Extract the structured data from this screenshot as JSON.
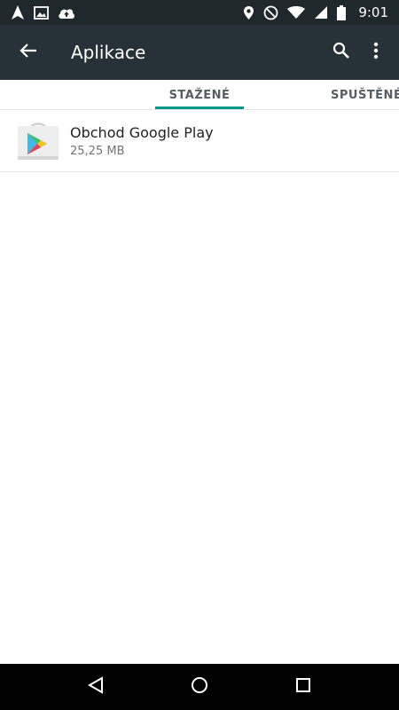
{
  "status_bar": {
    "time": "9:01",
    "left_icons": [
      "navigation-arrow-icon",
      "image-icon",
      "cloud-upload-icon"
    ],
    "right_icons": [
      "location-pin-icon",
      "do-not-disturb-icon",
      "wifi-icon",
      "cellular-signal-icon",
      "battery-icon"
    ]
  },
  "app_bar": {
    "title": "Aplikace",
    "background": "#263238"
  },
  "tabs": [
    {
      "label": "STAŽENÉ",
      "selected": true
    },
    {
      "label": "SPUŠTĚNÉ",
      "selected": false
    }
  ],
  "accent_color": "#009688",
  "apps": [
    {
      "name": "Obchod Google Play",
      "size": "25,25 MB",
      "icon": "google-play-store-icon"
    }
  ],
  "nav_bar": {
    "buttons": [
      "back-triangle-icon",
      "home-circle-icon",
      "recents-square-icon"
    ]
  }
}
